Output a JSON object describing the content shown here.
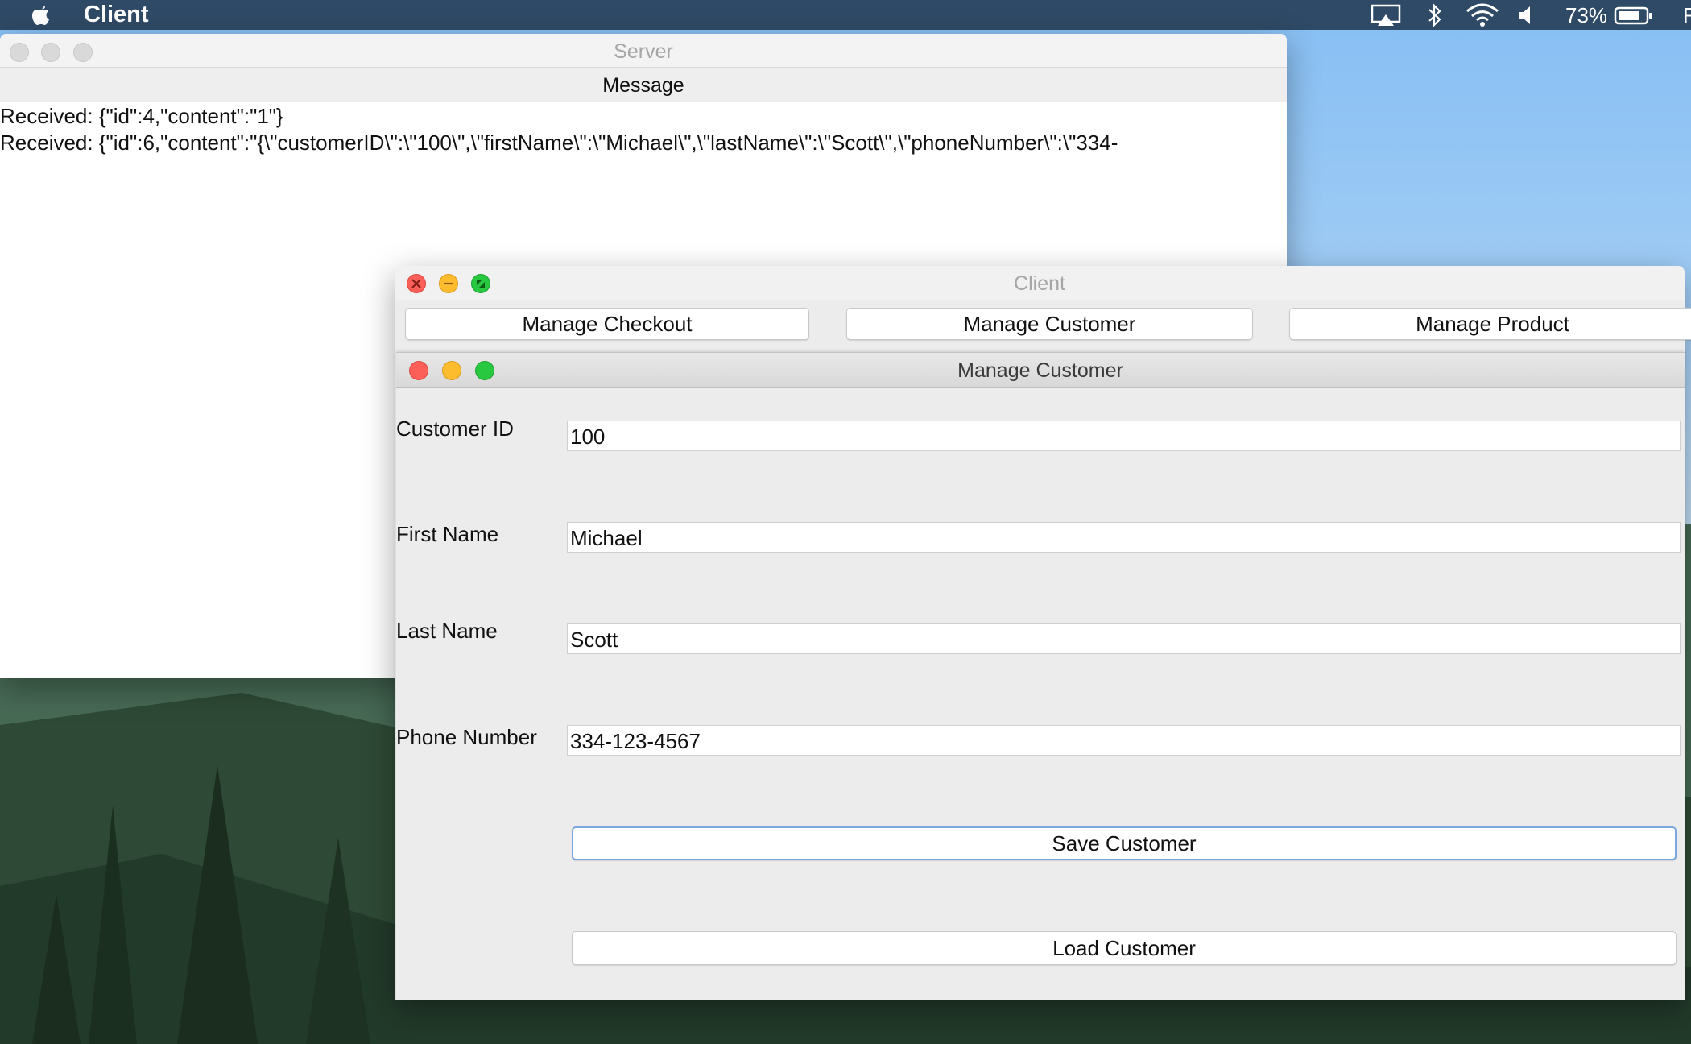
{
  "menubar": {
    "app_name": "Client",
    "battery_percent": "73%",
    "clipped_right_text": "F",
    "icons": [
      "apple-icon",
      "airplay-icon",
      "bluetooth-icon",
      "wifi-icon",
      "volume-icon",
      "battery-icon"
    ]
  },
  "server_window": {
    "title": "Server",
    "message_header": "Message",
    "log_lines": [
      "Received: {\"id\":4,\"content\":\"1\"}",
      "Received: {\"id\":6,\"content\":\"{\\\"customerID\\\":\\\"100\\\",\\\"firstName\\\":\\\"Michael\\\",\\\"lastName\\\":\\\"Scott\\\",\\\"phoneNumber\\\":\\\"334-"
    ]
  },
  "client_window": {
    "title": "Client",
    "tabs": [
      "Manage Checkout",
      "Manage Customer",
      "Manage Product"
    ],
    "manage_customer": {
      "title": "Manage Customer",
      "fields": {
        "customer_id": {
          "label": "Customer ID",
          "value": "100"
        },
        "first_name": {
          "label": "First Name",
          "value": "Michael"
        },
        "last_name": {
          "label": "Last Name",
          "value": "Scott"
        },
        "phone_number": {
          "label": "Phone Number",
          "value": "334-123-4567"
        }
      },
      "save_button": "Save Customer",
      "load_button": "Load Customer"
    }
  },
  "colors": {
    "menubar": "#2f4a66",
    "close": "#fc5f57",
    "minimize": "#fdbb2e",
    "zoom": "#28c840",
    "focus_ring": "#7aa7dd"
  }
}
